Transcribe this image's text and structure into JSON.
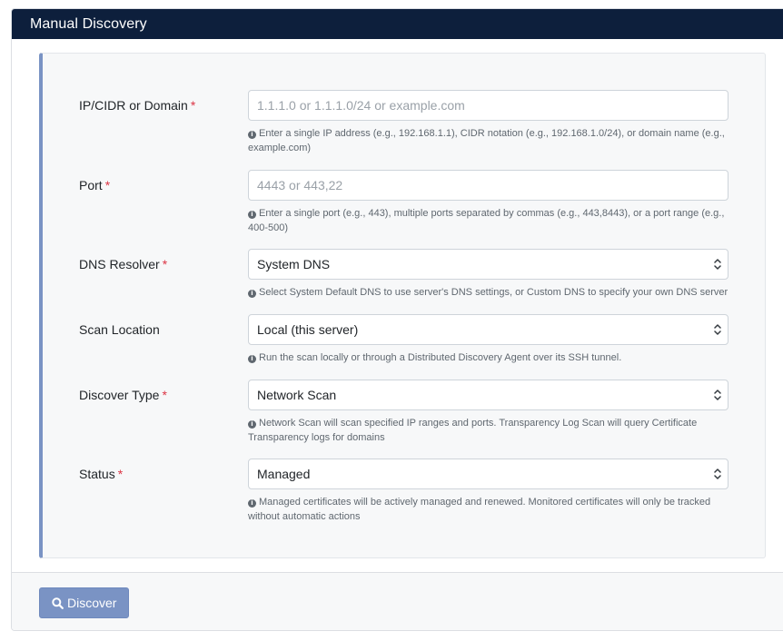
{
  "header": {
    "title": "Manual Discovery"
  },
  "form": {
    "required_marker": "*",
    "info_glyph": "i",
    "ip": {
      "label": "IP/CIDR or Domain",
      "placeholder": "1.1.1.0 or 1.1.1.0/24 or example.com",
      "value": "",
      "help": "Enter a single IP address (e.g., 192.168.1.1), CIDR notation (e.g., 192.168.1.0/24), or domain name (e.g., example.com)"
    },
    "port": {
      "label": "Port",
      "placeholder": "4443 or 443,22",
      "value": "",
      "help": "Enter a single port (e.g., 443), multiple ports separated by commas (e.g., 443,8443), or a port range (e.g., 400-500)"
    },
    "dns": {
      "label": "DNS Resolver",
      "selected": "System DNS",
      "help": "Select System Default DNS to use server's DNS settings, or Custom DNS to specify your own DNS server"
    },
    "location": {
      "label": "Scan Location",
      "selected": "Local (this server)",
      "help": "Run the scan locally or through a Distributed Discovery Agent over its SSH tunnel."
    },
    "type": {
      "label": "Discover Type",
      "selected": "Network Scan",
      "help": "Network Scan will scan specified IP ranges and ports. Transparency Log Scan will query Certificate Transparency logs for domains"
    },
    "status": {
      "label": "Status",
      "selected": "Managed",
      "help": "Managed certificates will be actively managed and renewed. Monitored certificates will only be tracked without automatic actions"
    }
  },
  "footer": {
    "discover_label": "Discover",
    "icon": "search-icon"
  },
  "colors": {
    "header_bg": "#0d1f3c",
    "accent": "#7a93c4",
    "required": "#dc3545"
  }
}
